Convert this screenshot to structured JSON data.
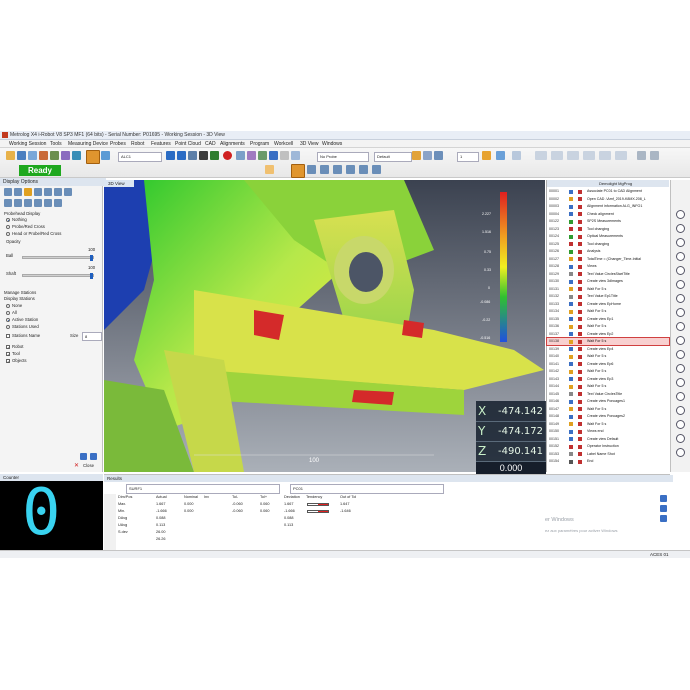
{
  "window": {
    "title": "Metrolog X4 i-Robot V8 SP3 MF1 (64 bits) - Serial Number: P01695 - Working Session - 3D View"
  },
  "menu": [
    "Working Session",
    "Tools",
    "Measuring Device",
    "Probes",
    "Robot",
    "Features",
    "Point Cloud",
    "CAD",
    "Alignments",
    "Program",
    "Workcell",
    "3D View",
    "Windows"
  ],
  "toolbar": {
    "status": "Ready",
    "align_combo": "ALC1",
    "probe_combo": "No Probe",
    "default_combo": "Default",
    "page_combo": "1"
  },
  "display_options": {
    "title": "Display Options",
    "probe_head_label": "Probehead Display",
    "probe_head_options": [
      {
        "label": "Nothing",
        "selected": true
      },
      {
        "label": "Probe/Red Cross",
        "selected": false
      },
      {
        "label": "Head or Probe/Red Cross",
        "selected": false
      }
    ],
    "opacity_label": "Opacity",
    "ball_label": "Ball",
    "ball_value": "100",
    "shaft_label": "Shaft",
    "shaft_value": "100",
    "manage_stations_label": "Manage Stations",
    "display_stations_label": "Display Stations",
    "station_options": [
      {
        "label": "None",
        "selected": false
      },
      {
        "label": "All",
        "selected": false
      },
      {
        "label": "Active Station",
        "selected": true
      },
      {
        "label": "Stations Used",
        "selected": false
      }
    ],
    "stations_name_label": "Stations Name",
    "size_label": "Size",
    "size_value": "8",
    "checks": [
      {
        "label": "Robot",
        "checked": true
      },
      {
        "label": "Tool",
        "checked": true
      },
      {
        "label": "Objects",
        "checked": true
      }
    ],
    "close_label": "Close"
  },
  "view": {
    "tab_label": "3D View",
    "scale_label": "100",
    "colorbar_labels": [
      "2.227",
      "1.516",
      "0.75",
      "0.33",
      "0",
      "-0.086",
      "-0.22",
      "-0.516"
    ],
    "coords": [
      {
        "axis": "X",
        "value": "-474.142"
      },
      {
        "axis": "Y",
        "value": "-474.172"
      },
      {
        "axis": "Z",
        "value": "-490.141"
      }
    ],
    "error": "0.000"
  },
  "tree": {
    "title": "Demolight MgProg",
    "rows": [
      {
        "id": "00001",
        "text": "Associate PC01 to CAD Alignment",
        "color": "#3a6fc4"
      },
      {
        "id": "00002",
        "text": "Open CAD .\\Amf_2019-K8MX.208_L",
        "color": "#e0a020"
      },
      {
        "id": "00003",
        "text": "Alignment information ALG_INFO1",
        "color": "#3a6fc4"
      },
      {
        "id": "00004",
        "text": "Check alignment",
        "color": "#3a6fc4"
      },
      {
        "id": "00122",
        "text": "SP2S Measurements",
        "color": "#2f9b2f"
      },
      {
        "id": "00123",
        "text": "Tool changing",
        "color": "#c03030"
      },
      {
        "id": "00124",
        "text": "Optical Measurements",
        "color": "#2f9b2f"
      },
      {
        "id": "00125",
        "text": "Tool changing",
        "color": "#c03030"
      },
      {
        "id": "00126",
        "text": "Analysis",
        "color": "#2f9b2f"
      },
      {
        "id": "00127",
        "text": "TotalTime = (Changer_Time-Initial",
        "color": "#e0a020"
      },
      {
        "id": "00128",
        "text": "Views",
        "color": "#3a6fc4"
      },
      {
        "id": "00129",
        "text": "Text Value CirclesStartTitle",
        "color": "#888888"
      },
      {
        "id": "00130",
        "text": "Create view 3dImages",
        "color": "#3a6fc4"
      },
      {
        "id": "00131",
        "text": "Wait For 5 s",
        "color": "#e0a020"
      },
      {
        "id": "00132",
        "text": "Text Value Ep1Title",
        "color": "#888888"
      },
      {
        "id": "00133",
        "text": "Create view EpHome",
        "color": "#3a6fc4"
      },
      {
        "id": "00134",
        "text": "Wait For 5 s",
        "color": "#e0a020"
      },
      {
        "id": "00135",
        "text": "Create view Ep1",
        "color": "#3a6fc4"
      },
      {
        "id": "00136",
        "text": "Wait For 5 s",
        "color": "#e0a020"
      },
      {
        "id": "00137",
        "text": "Create view Ep2",
        "color": "#3a6fc4"
      },
      {
        "id": "00138",
        "text": "Wait For 5 s",
        "color": "#e0a020"
      },
      {
        "id": "00139",
        "text": "Create view Ep4",
        "color": "#3a6fc4"
      },
      {
        "id": "00140",
        "text": "Wait For 5 s",
        "color": "#e0a020"
      },
      {
        "id": "00141",
        "text": "Create view Ep6",
        "color": "#3a6fc4"
      },
      {
        "id": "00142",
        "text": "Wait For 5 s",
        "color": "#e0a020"
      },
      {
        "id": "00143",
        "text": "Create view Ep3",
        "color": "#3a6fc4"
      },
      {
        "id": "00144",
        "text": "Wait For 5 s",
        "color": "#e0a020"
      },
      {
        "id": "00145",
        "text": "Text Value CirclesTitle",
        "color": "#888888"
      },
      {
        "id": "00146",
        "text": "Create view Poncages1",
        "color": "#3a6fc4"
      },
      {
        "id": "00147",
        "text": "Wait For 5 s",
        "color": "#e0a020"
      },
      {
        "id": "00148",
        "text": "Create view Poncages2",
        "color": "#3a6fc4"
      },
      {
        "id": "00149",
        "text": "Wait For 5 s",
        "color": "#e0a020"
      },
      {
        "id": "00150",
        "text": "Views end",
        "color": "#3a6fc4"
      },
      {
        "id": "00151",
        "text": "Create view Default",
        "color": "#3a6fc4"
      },
      {
        "id": "00152",
        "text": "Operator Instruction",
        "color": "#c03030"
      },
      {
        "id": "00153",
        "text": "Label Name Shot",
        "color": "#888888"
      },
      {
        "id": "00154",
        "text": "End",
        "color": "#555555"
      }
    ],
    "selected_index": 20
  },
  "counter": {
    "title": "Counter",
    "digit": "0"
  },
  "results": {
    "title": "Results",
    "combo1": "SURF1",
    "combo2": "PC01",
    "columns": [
      "Dim/Pos",
      "Actual",
      "Nominal",
      "Inv",
      "Tol-",
      "Tol+",
      "Deviation",
      "Tendency",
      "Out of Tol"
    ],
    "rows": [
      [
        "Max.",
        "1.667",
        "0.000",
        "",
        "-0.060",
        "0.060",
        "1.667",
        "",
        "1.647"
      ],
      [
        "Min.",
        "-1.666",
        "0.000",
        "",
        "-0.060",
        "0.060",
        "-1.666",
        "",
        "-1.646"
      ],
      [
        "DAvg",
        "0.088",
        "",
        "",
        "",
        "",
        "0.088",
        "",
        ""
      ],
      [
        "UAvg",
        "0.113",
        "",
        "",
        "",
        "",
        "0.113",
        "",
        ""
      ],
      [
        "S.dev",
        "26.00",
        "",
        "",
        "",
        "",
        "",
        "",
        ""
      ],
      [
        "",
        "26.26",
        "",
        "",
        "",
        "",
        "",
        "",
        ""
      ]
    ]
  },
  "watermark": {
    "line1": "er Windows",
    "line2": "ez aux paramètres pour activer Windows"
  },
  "statusbar": {
    "right": "ACES 01"
  }
}
